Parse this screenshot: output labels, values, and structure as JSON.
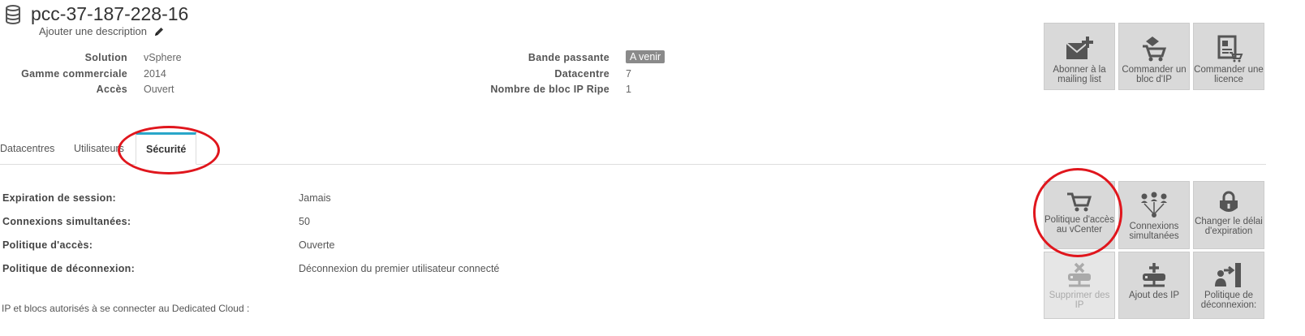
{
  "header": {
    "title": "pcc-37-187-228-16",
    "description_link": "Ajouter une description"
  },
  "info_left": [
    {
      "label": "Solution",
      "value": "vSphere"
    },
    {
      "label": "Gamme commerciale",
      "value": "2014"
    },
    {
      "label": "Accès",
      "value": "Ouvert"
    }
  ],
  "info_right": [
    {
      "label": "Bande passante",
      "value": "A venir"
    },
    {
      "label": "Datacentre",
      "value": "7"
    },
    {
      "label": "Nombre de bloc IP Ripe",
      "value": "1"
    }
  ],
  "top_actions": [
    {
      "label": "Abonner à la mailing list",
      "icon": "mail-add-icon"
    },
    {
      "label": "Commander un bloc d'IP",
      "icon": "cart-ip-icon"
    },
    {
      "label": "Commander une licence",
      "icon": "license-icon"
    }
  ],
  "tabs": [
    {
      "label": "Datacentres",
      "active": false
    },
    {
      "label": "Utilisateurs",
      "active": false
    },
    {
      "label": "Sécurité",
      "active": true
    }
  ],
  "security": [
    {
      "label": "Expiration de session:",
      "value": "Jamais"
    },
    {
      "label": "Connexions simultanées:",
      "value": "50"
    },
    {
      "label": "Politique d'accès:",
      "value": "Ouverte"
    },
    {
      "label": "Politique de déconnexion:",
      "value": "Déconnexion du premier utilisateur connecté"
    }
  ],
  "ip_section_text": "IP et blocs autorisés à se connecter au Dedicated Cloud :",
  "security_actions": [
    {
      "label": "Politique d'accès au vCenter",
      "icon": "cart-icon",
      "enabled": true
    },
    {
      "label": "Connexions simultanées",
      "icon": "network-users-icon",
      "enabled": true
    },
    {
      "label": "Changer le délai d'expiration",
      "icon": "lock-icon",
      "enabled": true
    },
    {
      "label": "Supprimer des IP",
      "icon": "remove-ip-icon",
      "enabled": false
    },
    {
      "label": "Ajout des IP",
      "icon": "add-ip-icon",
      "enabled": true
    },
    {
      "label": "Politique de déconnexion:",
      "icon": "logout-user-icon",
      "enabled": true
    }
  ],
  "colors": {
    "tab_accent": "#29a6c9",
    "annotation_ring": "#e0161d",
    "tile_bg": "#d9d9d9",
    "badge_bg": "#8a8a8a"
  }
}
